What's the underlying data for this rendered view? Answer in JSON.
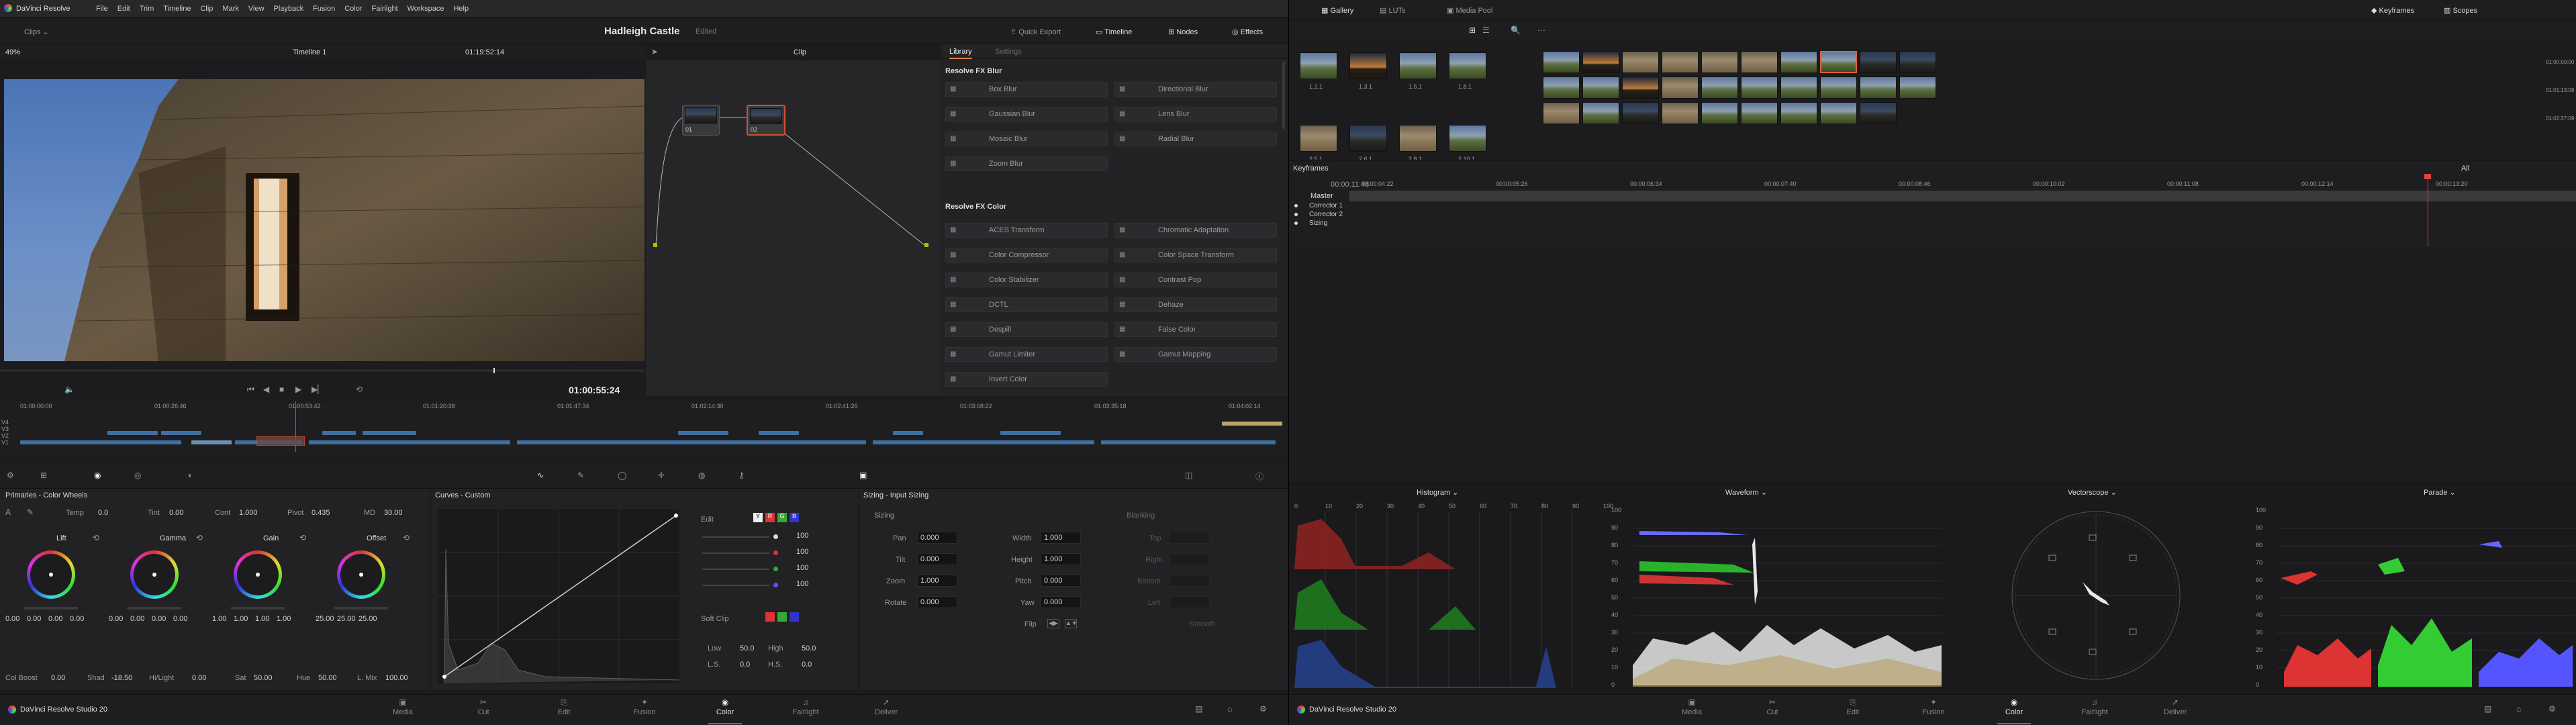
{
  "left": {
    "menubar": {
      "app": "DaVinci Resolve",
      "items": [
        "File",
        "Edit",
        "Trim",
        "Timeline",
        "Clip",
        "Mark",
        "View",
        "Playback",
        "Fusion",
        "Color",
        "Fairlight",
        "Workspace",
        "Help"
      ]
    },
    "header": {
      "clips": "Clips",
      "title": "Hadleigh Castle",
      "status": "Edited",
      "quick_export": "Quick Export",
      "timeline": "Timeline",
      "nodes": "Nodes",
      "effects": "Effects"
    },
    "viewer_bar": {
      "zoom": "49%",
      "timeline_name": "Timeline 1",
      "timecode": "01:19:52:14",
      "mode": "Clip"
    },
    "viewer": {
      "timecode": "01:00:55:24"
    },
    "nodes": [
      {
        "label": "01"
      },
      {
        "label": "02"
      }
    ],
    "library": {
      "tab1": "Library",
      "tab2": "Settings",
      "section1": "Resolve FX Blur",
      "blur": [
        "Box Blur",
        "Directional Blur",
        "Gaussian Blur",
        "Lens Blur",
        "Mosaic Blur",
        "Radial Blur",
        "Zoom Blur"
      ],
      "section2": "Resolve FX Color",
      "color": [
        "ACES Transform",
        "Chromatic Adaptation",
        "Color Compressor",
        "Color Space Transform",
        "Color Stabilizer",
        "Contrast Pop",
        "DCTL",
        "Dehaze",
        "Despill",
        "False Color",
        "Gamut Limiter",
        "Gamut Mapping",
        "Invert Color"
      ]
    },
    "mini_timeline": {
      "ticks": [
        "01:00:00:00",
        "01:00:26:46",
        "01:00:53:42",
        "01:01:20:38",
        "01:01:47:34",
        "01:02:14:30",
        "01:02:41:26",
        "01:03:08:22",
        "01:03:35:18",
        "01:04:02:14"
      ],
      "tracks": [
        "V4",
        "V3",
        "V2",
        "V1"
      ]
    },
    "primaries": {
      "title": "Primaries - Color Wheels",
      "temp_label": "Temp",
      "temp": "0.0",
      "tint_label": "Tint",
      "tint": "0.00",
      "cont_label": "Cont",
      "cont": "1.000",
      "pivot_label": "Pivot",
      "pivot": "0.435",
      "md_label": "MD",
      "md": "30.00",
      "wheels": [
        {
          "name": "Lift",
          "vals": [
            "0.00",
            "0.00",
            "0.00",
            "0.00"
          ]
        },
        {
          "name": "Gamma",
          "vals": [
            "0.00",
            "0.00",
            "0.00",
            "0.00"
          ]
        },
        {
          "name": "Gain",
          "vals": [
            "1.00",
            "1.00",
            "1.00",
            "1.00"
          ]
        },
        {
          "name": "Offset",
          "vals": [
            "25.00",
            "25.00",
            "25.00"
          ]
        }
      ],
      "col_boost_label": "Col Boost",
      "col_boost": "0.00",
      "shad_label": "Shad",
      "shad": "-18.50",
      "hilight_label": "Hi/Light",
      "hilight": "0.00",
      "sat_label": "Sat",
      "sat": "50.00",
      "hue_label": "Hue",
      "hue": "50.00",
      "lmix_label": "L. Mix",
      "lmix": "100.00"
    },
    "curves": {
      "title": "Curves - Custom",
      "edit": "Edit",
      "values": [
        "100",
        "100",
        "100",
        "100"
      ],
      "softclip": "Soft Clip",
      "low_label": "Low",
      "low": "50.0",
      "high_label": "High",
      "high": "50.0",
      "ls_label": "L.S.",
      "ls": "0.0",
      "hs_label": "H.S.",
      "hs": "0.0"
    },
    "sizing": {
      "title": "Sizing - Input Sizing",
      "section": "Sizing",
      "blanking": "Blanking",
      "pan_label": "Pan",
      "pan": "0.000",
      "tilt_label": "Tilt",
      "tilt": "0.000",
      "zoom_label": "Zoom",
      "zoom": "1.000",
      "rotate_label": "Rotate",
      "rotate": "0.000",
      "width_label": "Width",
      "width": "1.000",
      "height_label": "Height",
      "height": "1.000",
      "pitch_label": "Pitch",
      "pitch": "0.000",
      "yaw_label": "Yaw",
      "yaw": "0.000",
      "flip_label": "Flip",
      "top": "Top",
      "right": "Right",
      "bottom": "Bottom",
      "left": "Left",
      "smooth": "Smooth"
    },
    "footer": {
      "product": "DaVinci Resolve Studio 20",
      "pages": [
        "Media",
        "Cut",
        "Edit",
        "Fusion",
        "Color",
        "Fairlight",
        "Deliver"
      ],
      "active": "Color"
    }
  },
  "right": {
    "tabs": {
      "gallery": "Gallery",
      "luts": "LUTs",
      "media_pool": "Media Pool",
      "keyframes": "Keyframes",
      "scopes": "Scopes"
    },
    "stills": [
      "1.1.1",
      "1.3.1",
      "1.5.1",
      "1.8.1",
      "2.5.1",
      "2.6.1",
      "2.8.1",
      "2.10.1"
    ],
    "timecodes": [
      "01:00:00:00",
      "01:01:13:08",
      "01:02:37:09"
    ],
    "keyframes": {
      "title": "Keyframes",
      "filter": "All",
      "current": "00:00:11:48",
      "ticks": [
        "00:00:04:22",
        "00:00:05:26",
        "00:00:06:34",
        "00:00:07:40",
        "00:00:08:46",
        "00:00:10:02",
        "00:00:11:08",
        "00:00:12:14",
        "00:00:13:20"
      ],
      "rows": [
        "Master",
        "Corrector 1",
        "Corrector 2",
        "Sizing"
      ]
    },
    "scopes": {
      "histogram": "Histogram",
      "waveform": "Waveform",
      "vectorscope": "Vectorscope",
      "parade": "Parade",
      "hist_ticks": [
        "0",
        "10",
        "20",
        "30",
        "40",
        "50",
        "60",
        "70",
        "80",
        "90",
        "100"
      ],
      "wave_ticks": [
        "100",
        "90",
        "80",
        "70",
        "60",
        "50",
        "40",
        "30",
        "20",
        "10",
        "0"
      ]
    },
    "footer": {
      "product": "DaVinci Resolve Studio 20",
      "pages": [
        "Media",
        "Cut",
        "Edit",
        "Fusion",
        "Color",
        "Fairlight",
        "Deliver"
      ],
      "active": "Color"
    }
  }
}
